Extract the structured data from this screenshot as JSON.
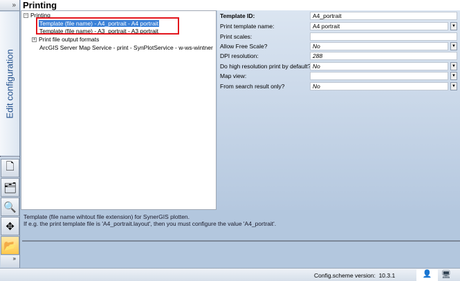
{
  "sidebar": {
    "expand": "»",
    "vertical_title": "Edit configuration",
    "more": "»"
  },
  "header": {
    "title": "Printing"
  },
  "tree": {
    "root": "Printing",
    "items": [
      "Template (file name) - A4_portrait - A4 portrait",
      "Template (file name) - A3_portrait - A3 portrait",
      "Print file output formats",
      "ArcGIS Server Map Service - print - SynPlotService - w-ws-wintner"
    ]
  },
  "props": [
    {
      "label": "Template ID:",
      "value": "A4_portrait"
    },
    {
      "label": "Print template name:",
      "value": "A4 portrait"
    },
    {
      "label": "Print scales:",
      "value": ""
    },
    {
      "label": "Allow Free Scale?",
      "value": "No"
    },
    {
      "label": "DPI resolution:",
      "value": "288"
    },
    {
      "label": "Do high resolution print by default?",
      "value": "No"
    },
    {
      "label": "Map view:",
      "value": ""
    },
    {
      "label": "From search result only?",
      "value": "No"
    }
  ],
  "help": {
    "line1": "Template (file name wihtout file extension) for SynerGIS plotten.",
    "line2": "If e.g. the print template file is 'A4_portrait.layout', then you must configure the value 'A4_portrait'."
  },
  "status": {
    "version_label": "Config.scheme version:",
    "version": "10.3.1"
  }
}
